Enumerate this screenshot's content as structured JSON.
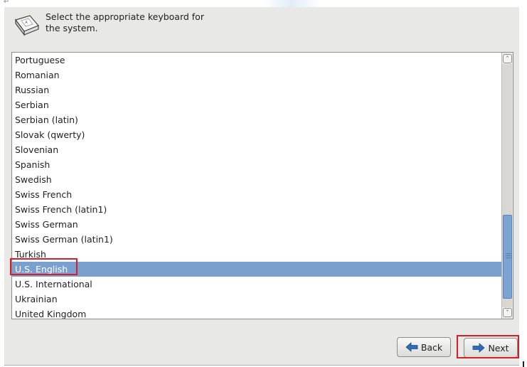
{
  "prompt": {
    "line1": "Select the appropriate keyboard for",
    "line2": "the system."
  },
  "keyboard_list": {
    "items": [
      {
        "label": "Portuguese",
        "selected": false
      },
      {
        "label": "Romanian",
        "selected": false
      },
      {
        "label": "Russian",
        "selected": false
      },
      {
        "label": "Serbian",
        "selected": false
      },
      {
        "label": "Serbian (latin)",
        "selected": false
      },
      {
        "label": "Slovak (qwerty)",
        "selected": false
      },
      {
        "label": "Slovenian",
        "selected": false
      },
      {
        "label": "Spanish",
        "selected": false
      },
      {
        "label": "Swedish",
        "selected": false
      },
      {
        "label": "Swiss French",
        "selected": false
      },
      {
        "label": "Swiss French (latin1)",
        "selected": false
      },
      {
        "label": "Swiss German",
        "selected": false
      },
      {
        "label": "Swiss German (latin1)",
        "selected": false
      },
      {
        "label": "Turkish",
        "selected": false
      },
      {
        "label": "U.S. English",
        "selected": true
      },
      {
        "label": "U.S. International",
        "selected": false
      },
      {
        "label": "Ukrainian",
        "selected": false
      },
      {
        "label": "United Kingdom",
        "selected": false
      }
    ],
    "selected_value": "U.S. English"
  },
  "buttons": {
    "back_label": "Back",
    "next_label": "Next",
    "back_icon": "arrow-left-icon",
    "next_icon": "arrow-right-icon"
  },
  "colors": {
    "window_bg": "#e8e8e7",
    "selection_bg": "#7aa0cf",
    "scroll_thumb": "#7ba4d4",
    "arrow_blue": "#2f6cb5",
    "annotation_red": "#d81e28"
  }
}
